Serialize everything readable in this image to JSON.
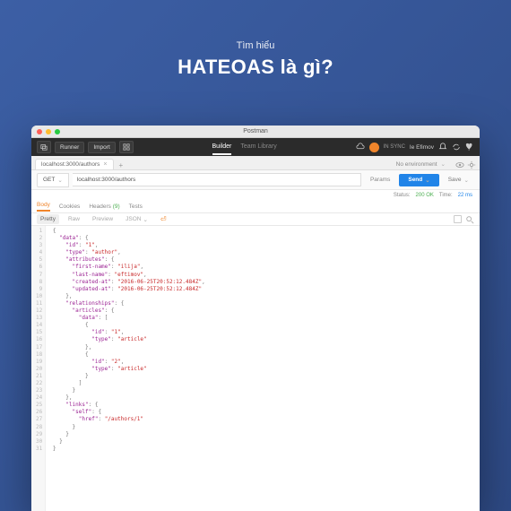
{
  "hero": {
    "small": "Tìm hiểu",
    "big": "HATEOAS là gì?"
  },
  "chrome": {
    "title": "Postman"
  },
  "topbar": {
    "runner": "Runner",
    "import": "Import",
    "builder": "Builder",
    "team": "Team Library",
    "sync": "IN SYNC",
    "user": "Ie Efimov"
  },
  "filetab": {
    "label": "localhost:3000/authors"
  },
  "env": {
    "label": "No environment"
  },
  "request": {
    "method": "GET",
    "url": "localhost:3000/authors",
    "params": "Params",
    "send": "Send",
    "save": "Save"
  },
  "status": {
    "status_label": "Status:",
    "status_value": "200 OK",
    "time_label": "Time:",
    "time_value": "22 ms"
  },
  "restabs": {
    "body": "Body",
    "cookies": "Cookies",
    "headers": "Headers",
    "headers_count": "(9)",
    "tests": "Tests"
  },
  "viewopts": {
    "pretty": "Pretty",
    "raw": "Raw",
    "preview": "Preview",
    "format": "JSON"
  },
  "json_lines": [
    [
      [
        "p",
        "{"
      ]
    ],
    [
      [
        "p",
        "  "
      ],
      [
        "k",
        "\"data\""
      ],
      [
        "p",
        ": {"
      ]
    ],
    [
      [
        "p",
        "    "
      ],
      [
        "k",
        "\"id\""
      ],
      [
        "p",
        ": "
      ],
      [
        "s",
        "\"1\""
      ],
      [
        "p",
        ","
      ]
    ],
    [
      [
        "p",
        "    "
      ],
      [
        "k",
        "\"type\""
      ],
      [
        "p",
        ": "
      ],
      [
        "s",
        "\"author\""
      ],
      [
        "p",
        ","
      ]
    ],
    [
      [
        "p",
        "    "
      ],
      [
        "k",
        "\"attributes\""
      ],
      [
        "p",
        ": {"
      ]
    ],
    [
      [
        "p",
        "      "
      ],
      [
        "k",
        "\"first-name\""
      ],
      [
        "p",
        ": "
      ],
      [
        "s",
        "\"ilija\""
      ],
      [
        "p",
        ","
      ]
    ],
    [
      [
        "p",
        "      "
      ],
      [
        "k",
        "\"last-name\""
      ],
      [
        "p",
        ": "
      ],
      [
        "s",
        "\"eftimov\""
      ],
      [
        "p",
        ","
      ]
    ],
    [
      [
        "p",
        "      "
      ],
      [
        "k",
        "\"created-at\""
      ],
      [
        "p",
        ": "
      ],
      [
        "s",
        "\"2016-06-25T20:52:12.484Z\""
      ],
      [
        "p",
        ","
      ]
    ],
    [
      [
        "p",
        "      "
      ],
      [
        "k",
        "\"updated-at\""
      ],
      [
        "p",
        ": "
      ],
      [
        "s",
        "\"2016-06-25T20:52:12.484Z\""
      ]
    ],
    [
      [
        "p",
        "    },"
      ]
    ],
    [
      [
        "p",
        "    "
      ],
      [
        "k",
        "\"relationships\""
      ],
      [
        "p",
        ": {"
      ]
    ],
    [
      [
        "p",
        "      "
      ],
      [
        "k",
        "\"articles\""
      ],
      [
        "p",
        ": {"
      ]
    ],
    [
      [
        "p",
        "        "
      ],
      [
        "k",
        "\"data\""
      ],
      [
        "p",
        ": ["
      ]
    ],
    [
      [
        "p",
        "          {"
      ]
    ],
    [
      [
        "p",
        "            "
      ],
      [
        "k",
        "\"id\""
      ],
      [
        "p",
        ": "
      ],
      [
        "s",
        "\"1\""
      ],
      [
        "p",
        ","
      ]
    ],
    [
      [
        "p",
        "            "
      ],
      [
        "k",
        "\"type\""
      ],
      [
        "p",
        ": "
      ],
      [
        "s",
        "\"article\""
      ]
    ],
    [
      [
        "p",
        "          },"
      ]
    ],
    [
      [
        "p",
        "          {"
      ]
    ],
    [
      [
        "p",
        "            "
      ],
      [
        "k",
        "\"id\""
      ],
      [
        "p",
        ": "
      ],
      [
        "s",
        "\"2\""
      ],
      [
        "p",
        ","
      ]
    ],
    [
      [
        "p",
        "            "
      ],
      [
        "k",
        "\"type\""
      ],
      [
        "p",
        ": "
      ],
      [
        "s",
        "\"article\""
      ]
    ],
    [
      [
        "p",
        "          }"
      ]
    ],
    [
      [
        "p",
        "        ]"
      ]
    ],
    [
      [
        "p",
        "      }"
      ]
    ],
    [
      [
        "p",
        "    },"
      ]
    ],
    [
      [
        "p",
        "    "
      ],
      [
        "k",
        "\"links\""
      ],
      [
        "p",
        ": {"
      ]
    ],
    [
      [
        "p",
        "      "
      ],
      [
        "k",
        "\"self\""
      ],
      [
        "p",
        ": {"
      ]
    ],
    [
      [
        "p",
        "        "
      ],
      [
        "k",
        "\"href\""
      ],
      [
        "p",
        ": "
      ],
      [
        "s",
        "\"/authors/1\""
      ]
    ],
    [
      [
        "p",
        "      }"
      ]
    ],
    [
      [
        "p",
        "    }"
      ]
    ],
    [
      [
        "p",
        "  }"
      ]
    ],
    [
      [
        "p",
        "}"
      ]
    ]
  ]
}
